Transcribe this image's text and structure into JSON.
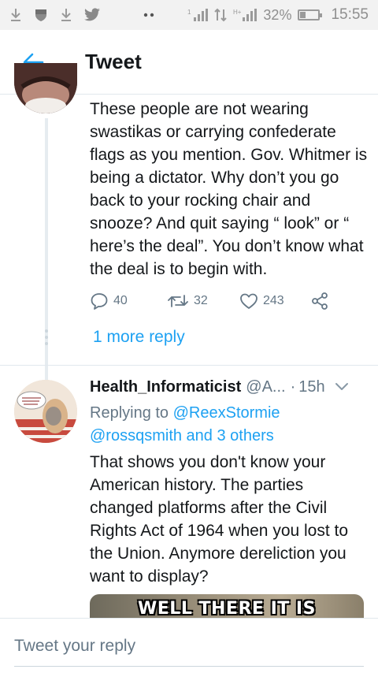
{
  "status_bar": {
    "signal_1": "1",
    "battery_percent": "32%",
    "battery_level": 0.32,
    "time": "15:55"
  },
  "header": {
    "title": "Tweet",
    "back_icon": "arrow-left-icon"
  },
  "tweet_thread": {
    "text": "These people are not wearing swastikas or carrying confederate flags as you mention.  Gov. Whitmer is being a dictator. Why don’t you go back to your rocking chair and snooze?  And quit saying “ look” or “ here’s the deal”.  You don’t know what the deal is to begin with.",
    "reply_count": "40",
    "retweet_count": "32",
    "like_count": "243",
    "more_replies": "1 more reply"
  },
  "tweet_reply": {
    "name": "Health_Informaticist",
    "handle": "@A...",
    "separator": "·",
    "time": "15h",
    "replying_prefix": "Replying to",
    "replying_mention": "@ReexStormie",
    "replying_rest": "@rossqsmith and 3 others",
    "text": "That shows you don't know your American history. The parties changed platforms after the Civil Rights Act of 1964 when you lost to the Union. Anymore dereliction you want to display?",
    "media_caption": "WELL THERE IT IS"
  },
  "compose": {
    "placeholder": "Tweet your reply"
  },
  "colors": {
    "accent": "#1da1f2",
    "secondary_text": "#657786",
    "divider": "#e1e8ed"
  }
}
